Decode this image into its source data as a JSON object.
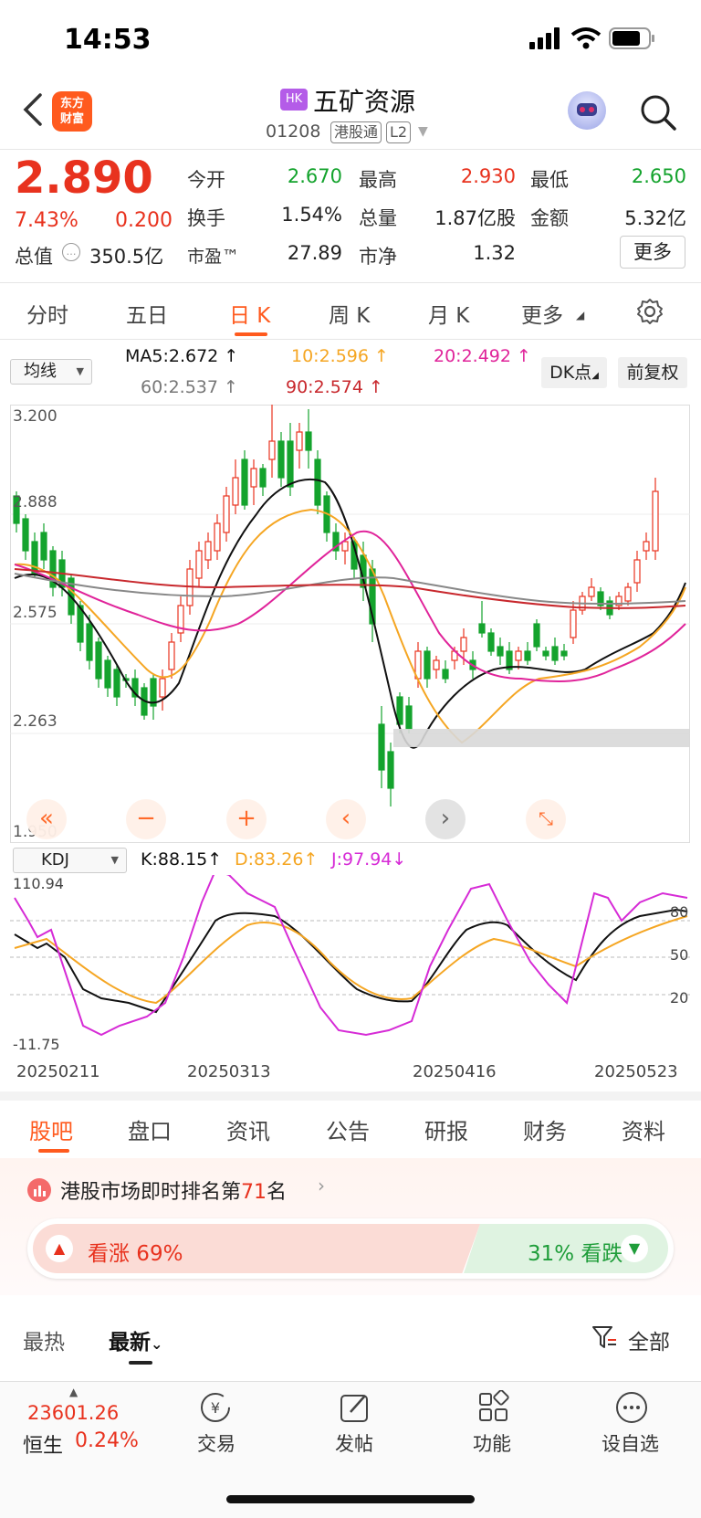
{
  "status": {
    "time": "14:53"
  },
  "header": {
    "app_logo": "东方\n财富",
    "market_badge": "HK",
    "stock_name": "五矿资源",
    "stock_code": "01208",
    "tags": [
      "港股通",
      "L2"
    ]
  },
  "quote": {
    "price": "2.890",
    "change_pct": "7.43%",
    "change": "0.200",
    "market_cap_label": "总值",
    "market_cap": "350.5亿",
    "fields": [
      {
        "label": "今开",
        "value": "2.670",
        "color": "green"
      },
      {
        "label": "最高",
        "value": "2.930",
        "color": "red"
      },
      {
        "label": "最低",
        "value": "2.650",
        "color": "green"
      },
      {
        "label": "换手",
        "value": "1.54%",
        "color": "black"
      },
      {
        "label": "总量",
        "value": "1.87亿股",
        "color": "black"
      },
      {
        "label": "金额",
        "value": "5.32亿",
        "color": "black"
      },
      {
        "label": "市盈™",
        "value": "27.89",
        "color": "black"
      },
      {
        "label": "市净",
        "value": "1.32",
        "color": "black"
      }
    ],
    "more_button": "更多"
  },
  "period_tabs": [
    "分时",
    "五日",
    "日 K",
    "周 K",
    "月 K",
    "更多"
  ],
  "ma": {
    "selector": "均线",
    "ma5": "MA5:2.672",
    "ma10": "10:2.596",
    "ma20": "20:2.492",
    "ma60": "60:2.537",
    "ma90": "90:2.574",
    "dk_button": "DK点",
    "adjust_button": "前复权",
    "colors": {
      "ma5": "#111111",
      "ma10": "#f5a623",
      "ma20": "#e0249a",
      "ma60": "#888888",
      "ma90": "#c8282d"
    }
  },
  "kchart_axis": [
    "3.200",
    "2.888",
    "2.575",
    "2.263",
    "1.950"
  ],
  "kdj": {
    "selector": "KDJ",
    "k": "K:88.15",
    "d": "D:83.26",
    "j": "J:97.94",
    "axis_left": [
      "110.94",
      "-11.75"
    ],
    "axis_right": [
      "80",
      "50",
      "20"
    ],
    "colors": {
      "k": "#111111",
      "d": "#f5a623",
      "j": "#d62bd6"
    }
  },
  "dates": [
    "20250211",
    "20250313",
    "20250416",
    "20250523"
  ],
  "section_tabs": [
    "股吧",
    "盘口",
    "资讯",
    "公告",
    "研报",
    "财务",
    "资料"
  ],
  "ranking": {
    "prefix": "港股市场即时排名第",
    "rank": "71",
    "suffix": "名"
  },
  "sentiment": {
    "bull": "看涨 69%",
    "bear": "31% 看跌"
  },
  "feed_tabs": {
    "hot": "最热",
    "new": "最新",
    "filter": "全部"
  },
  "bottom": {
    "index_value": "23601.26",
    "index_name": "恒生",
    "index_pct": "0.24%",
    "nav": [
      "交易",
      "发帖",
      "功能",
      "设自选"
    ]
  }
}
